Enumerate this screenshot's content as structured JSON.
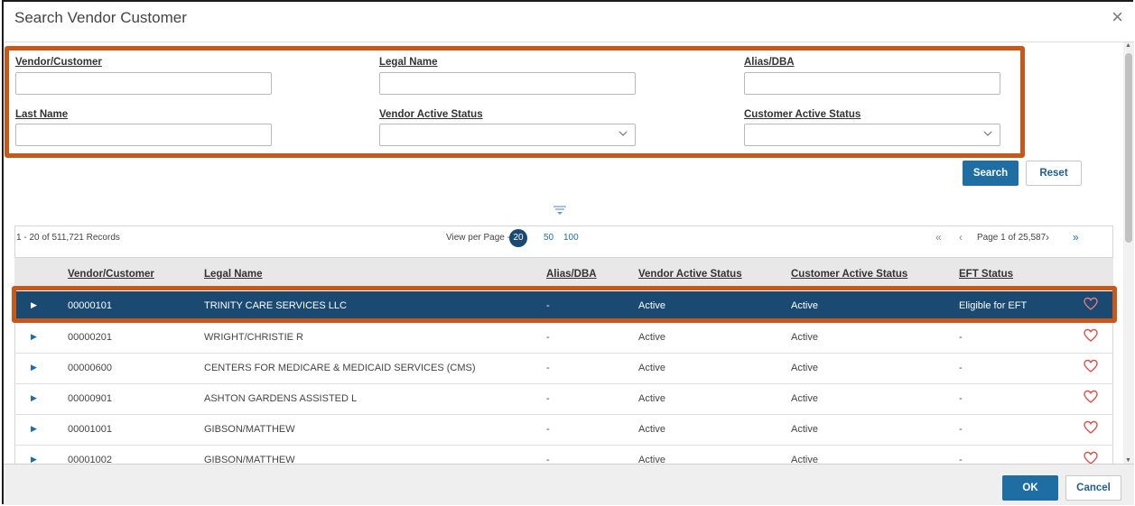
{
  "dialog": {
    "title": "Search Vendor Customer",
    "close_icon": "×"
  },
  "filters": {
    "vendor_customer": {
      "label": "Vendor/Customer",
      "value": ""
    },
    "legal_name": {
      "label": "Legal Name",
      "value": ""
    },
    "alias_dba": {
      "label": "Alias/DBA",
      "value": ""
    },
    "last_name": {
      "label": "Last Name",
      "value": ""
    },
    "vendor_active_status": {
      "label": "Vendor Active Status",
      "value": ""
    },
    "customer_active_status": {
      "label": "Customer Active Status",
      "value": ""
    }
  },
  "actions": {
    "search": "Search",
    "reset": "Reset",
    "ok": "OK",
    "cancel": "Cancel"
  },
  "results": {
    "record_count": "1 - 20 of 511,721 Records",
    "view_per_page_label": "View per Page -",
    "view_per_page_options": [
      "20",
      "50",
      "100"
    ],
    "selected_per_page": "20",
    "page_text": "Page 1 of 25,587",
    "nav": {
      "first": "«",
      "prev": "‹",
      "next": "›",
      "last": "»"
    }
  },
  "table": {
    "columns": [
      "Vendor/Customer",
      "Legal Name",
      "Alias/DBA",
      "Vendor Active Status",
      "Customer Active Status",
      "EFT Status"
    ],
    "rows": [
      {
        "id": "00000101",
        "legal": "TRINITY CARE SERVICES LLC",
        "alias": "-",
        "vendor": "Active",
        "customer": "Active",
        "eft": "Eligible for EFT",
        "selected": true
      },
      {
        "id": "00000201",
        "legal": "WRIGHT/CHRISTIE R",
        "alias": "-",
        "vendor": "Active",
        "customer": "Active",
        "eft": "-"
      },
      {
        "id": "00000600",
        "legal": "CENTERS FOR MEDICARE & MEDICAID SERVICES (CMS)",
        "alias": "-",
        "vendor": "Active",
        "customer": "Active",
        "eft": "-"
      },
      {
        "id": "00000901",
        "legal": "ASHTON GARDENS ASSISTED L",
        "alias": "-",
        "vendor": "Active",
        "customer": "Active",
        "eft": "-"
      },
      {
        "id": "00001001",
        "legal": "GIBSON/MATTHEW",
        "alias": "-",
        "vendor": "Active",
        "customer": "Active",
        "eft": "-"
      },
      {
        "id": "00001002",
        "legal": "GIBSON/MATTHEW",
        "alias": "-",
        "vendor": "Active",
        "customer": "Active",
        "eft": "-"
      }
    ]
  },
  "colors": {
    "accent": "#1f6ea3",
    "selected_row": "#1a4a72",
    "highlight_border": "#c8581a",
    "heart": "#d9534f"
  },
  "icons": {
    "expand": "caret-right-icon",
    "favorite": "heart-outline-icon",
    "filter": "filter-toggle-icon",
    "select": "chevron-down-icon"
  }
}
